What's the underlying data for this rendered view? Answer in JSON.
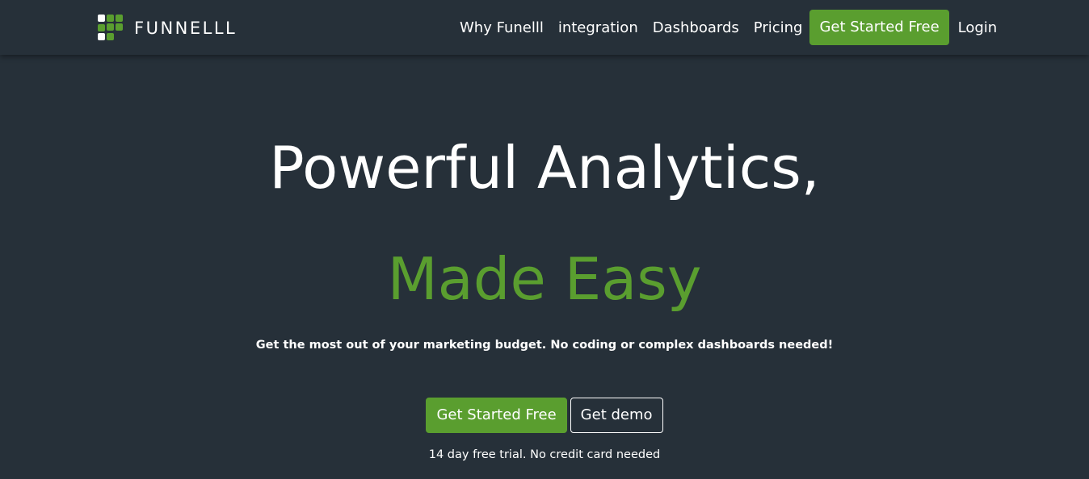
{
  "brand": {
    "name": "FUNNELLL",
    "logo_icon": "funnel-grid-logo",
    "colors": {
      "background": "#263039",
      "accent": "#5a9e2f",
      "text": "#ffffff"
    }
  },
  "nav": {
    "links": [
      {
        "label": "Why Funelll"
      },
      {
        "label": "integration"
      },
      {
        "label": "Dashboards"
      },
      {
        "label": "Pricing"
      }
    ],
    "cta_label": "Get Started Free",
    "login_label": "Login"
  },
  "hero": {
    "title_line1": "Powerful Analytics,",
    "title_line2": "Made Easy",
    "subtitle": "Get the most out of your marketing budget. No coding or complex dashboards needed!",
    "primary_button": "Get Started Free",
    "secondary_button": "Get demo",
    "note": "14 day free trial. No credit card needed"
  }
}
